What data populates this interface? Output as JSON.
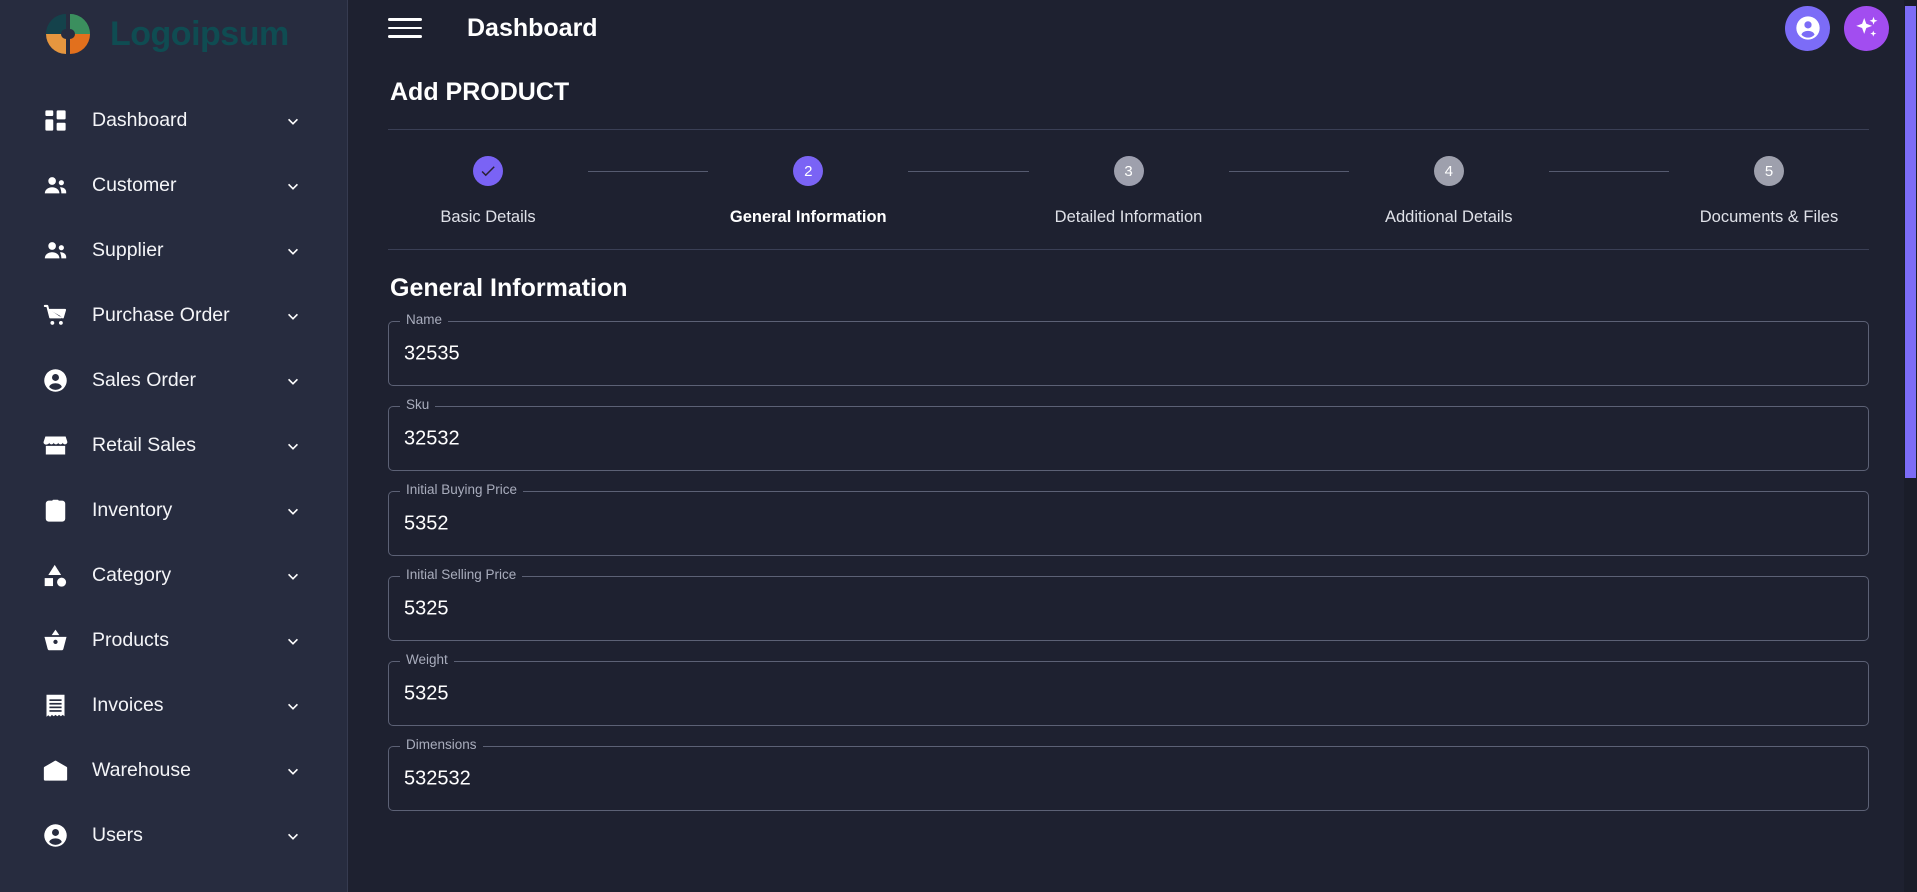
{
  "brand": {
    "name": "Logoipsum",
    "logo_icon": "pinwheel-logo-icon",
    "colors": {
      "teal": "#0f4c52",
      "green": "#3b8f5e",
      "light_orange": "#e5963f",
      "dark_orange": "#e2701d"
    }
  },
  "topbar": {
    "menu_icon": "hamburger-menu-icon",
    "title": "Dashboard",
    "account_icon": "account-circle-icon",
    "ai_icon": "sparkle-icon",
    "account_color": "#7c6cf7",
    "ai_color": "#a24df0"
  },
  "sidebar": {
    "items": [
      {
        "label": "Dashboard",
        "icon": "dashboard-grid-icon",
        "chevron": "chevron-down-icon"
      },
      {
        "label": "Customer",
        "icon": "people-icon",
        "chevron": "chevron-down-icon"
      },
      {
        "label": "Supplier",
        "icon": "people-icon",
        "chevron": "chevron-down-icon"
      },
      {
        "label": "Purchase Order",
        "icon": "shopping-cart-icon",
        "chevron": "chevron-down-icon"
      },
      {
        "label": "Sales Order",
        "icon": "account-circle-icon",
        "chevron": "chevron-down-icon"
      },
      {
        "label": "Retail Sales",
        "icon": "storefront-icon",
        "chevron": "chevron-down-icon"
      },
      {
        "label": "Inventory",
        "icon": "clipboard-check-icon",
        "chevron": "chevron-down-icon"
      },
      {
        "label": "Category",
        "icon": "shapes-category-icon",
        "chevron": "chevron-down-icon"
      },
      {
        "label": "Products",
        "icon": "shopping-basket-icon",
        "chevron": "chevron-down-icon"
      },
      {
        "label": "Invoices",
        "icon": "receipt-icon",
        "chevron": "chevron-down-icon"
      },
      {
        "label": "Warehouse",
        "icon": "warehouse-icon",
        "chevron": "chevron-down-icon"
      },
      {
        "label": "Users",
        "icon": "account-circle-icon",
        "chevron": "chevron-down-icon"
      }
    ]
  },
  "main": {
    "heading": "Add PRODUCT",
    "stepper": {
      "steps": [
        {
          "number": "1",
          "marker": "check",
          "label": "Basic Details",
          "state": "done"
        },
        {
          "number": "2",
          "marker": "2",
          "label": "General Information",
          "state": "active"
        },
        {
          "number": "3",
          "marker": "3",
          "label": "Detailed Information",
          "state": "upcoming"
        },
        {
          "number": "4",
          "marker": "4",
          "label": "Additional Details",
          "state": "upcoming"
        },
        {
          "number": "5",
          "marker": "5",
          "label": "Documents & Files",
          "state": "upcoming"
        }
      ],
      "active_color": "#7a63f5",
      "upcoming_color": "#9ea0ad"
    },
    "form": {
      "title": "General Information",
      "fields": [
        {
          "label": "Name",
          "value": "32535"
        },
        {
          "label": "Sku",
          "value": "32532"
        },
        {
          "label": "Initial Buying Price",
          "value": "5352"
        },
        {
          "label": "Initial Selling Price",
          "value": "5325"
        },
        {
          "label": "Weight",
          "value": "5325"
        },
        {
          "label": "Dimensions",
          "value": "532532"
        }
      ]
    }
  },
  "scrollbar": {
    "name": "vertical-scrollbar",
    "thumb_color": "#7c6cf7"
  }
}
